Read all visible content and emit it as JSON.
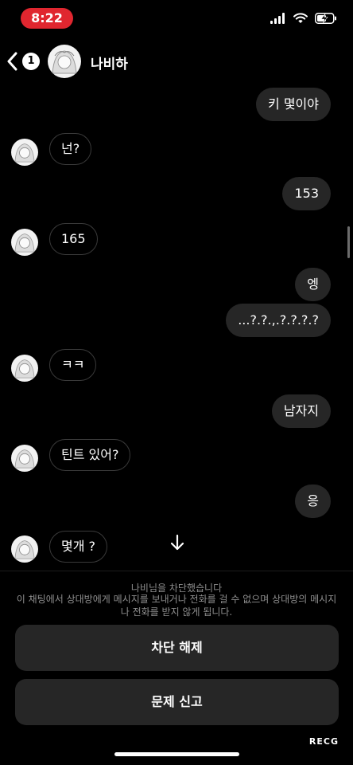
{
  "status_bar": {
    "time": "8:22",
    "time_color": "#e0262f",
    "icons": [
      "signal-icon",
      "wifi-icon",
      "battery-charging-icon"
    ]
  },
  "header": {
    "back_badge": "1",
    "contact_name": "나비하"
  },
  "messages": [
    {
      "dir": "out",
      "text": "키 몇이야"
    },
    {
      "dir": "in",
      "text": "넌?"
    },
    {
      "dir": "out",
      "text": "153"
    },
    {
      "dir": "in",
      "text": "165"
    },
    {
      "dir": "out",
      "text": "엥"
    },
    {
      "dir": "out",
      "text": "...?.?.,.?.?.?.?"
    },
    {
      "dir": "in",
      "text": "ㅋㅋ"
    },
    {
      "dir": "out",
      "text": "남자지"
    },
    {
      "dir": "in",
      "text": "틴트 있어?"
    },
    {
      "dir": "out",
      "text": "응"
    },
    {
      "dir": "in",
      "text": "몇개 ?"
    }
  ],
  "blocked": {
    "title": "나비님을 차단했습니다",
    "description": "이 채팅에서 상대방에게 메시지를 보내거나 전화를 걸 수 없으며 상대방의 메시지나 전화를 받지 않게 됩니다."
  },
  "actions": {
    "unblock_label": "차단 해제",
    "report_label": "문제 신고"
  },
  "watermark": "RECG",
  "colors": {
    "outgoing_bubble": "#262626",
    "incoming_border": "#3a3a3a",
    "button_bg": "#262626"
  }
}
